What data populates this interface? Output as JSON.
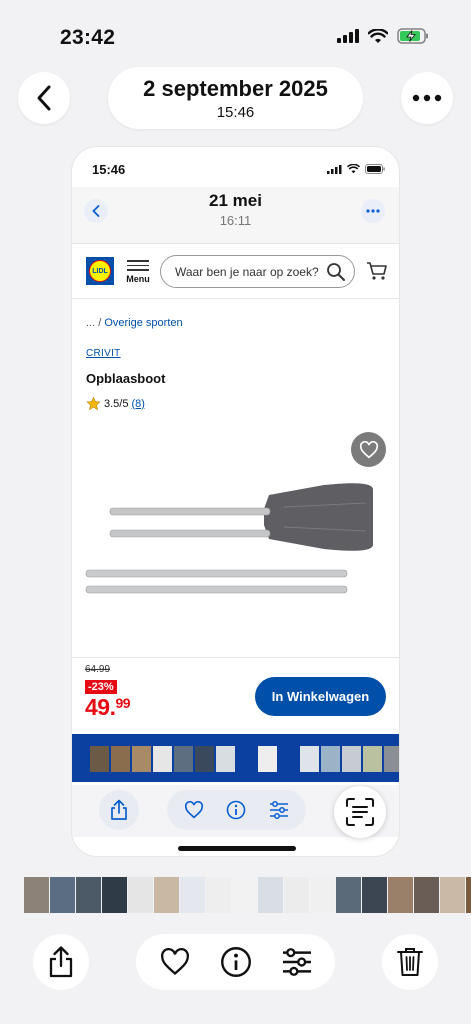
{
  "status_bar": {
    "time": "23:42"
  },
  "header": {
    "date": "2 september 2025",
    "time": "15:46"
  },
  "inner": {
    "status_time": "15:46",
    "header": {
      "date": "21 mei",
      "time": "16:11"
    },
    "lidl": {
      "logo_text": "LIDL",
      "menu_label": "Menu",
      "search_placeholder": "Waar ben je naar op zoek?"
    },
    "product": {
      "breadcrumb_prefix": "... /",
      "breadcrumb_link": "Overige sporten",
      "brand": "CRIVIT",
      "title": "Opblaasboot",
      "rating": "3.5/5",
      "review_count": "(8)",
      "old_price": "64.99",
      "discount": "-23%",
      "price_whole": "49.",
      "price_cents": "99",
      "cta": "In Winkelwagen"
    }
  },
  "icons": {
    "back": "chevron-left-icon",
    "more": "ellipsis-icon",
    "share": "share-icon",
    "favorite": "heart-icon",
    "info": "info-icon",
    "adjust": "sliders-icon",
    "delete": "trash-icon",
    "scan": "text-scan-icon",
    "search": "magnifier-icon",
    "cart": "cart-icon"
  },
  "colors": {
    "lidl_blue": "#0050aa",
    "lidl_red": "#e60a14",
    "lidl_yellow": "#fff200",
    "background": "#f2f2f4"
  }
}
